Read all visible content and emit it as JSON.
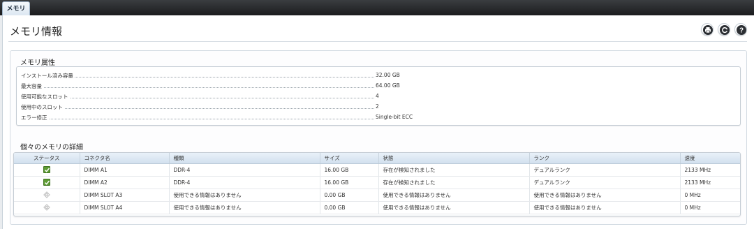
{
  "tab": {
    "label": "メモリ"
  },
  "page": {
    "title": "メモリ情報"
  },
  "toolbar": {
    "icons": [
      "printer-icon",
      "refresh-icon",
      "help-icon"
    ]
  },
  "memory_attributes": {
    "title": "メモリ属性",
    "rows": [
      {
        "label": "インストール済み容量",
        "value": "32.00 GB"
      },
      {
        "label": "最大容量",
        "value": "64.00 GB"
      },
      {
        "label": "使用可能なスロット",
        "value": "4"
      },
      {
        "label": "使用中のスロット",
        "value": "2"
      },
      {
        "label": "エラー修正",
        "value": "Single-bit ECC"
      }
    ]
  },
  "memory_details": {
    "title": "個々のメモリの詳細",
    "columns": [
      "ステータス",
      "コネクタ名",
      "種類",
      "サイズ",
      "状態",
      "ランク",
      "速度"
    ],
    "rows": [
      {
        "status_icon": "ok-check-icon",
        "connector": "DIMM A1",
        "type": "DDR-4",
        "size": "16.00 GB",
        "state": "存在が検知されました",
        "rank": "デュアルランク",
        "speed": "2133 MHz"
      },
      {
        "status_icon": "ok-check-icon",
        "connector": "DIMM A2",
        "type": "DDR-4",
        "size": "16.00 GB",
        "state": "存在が検知されました",
        "rank": "デュアルランク",
        "speed": "2133 MHz"
      },
      {
        "status_icon": "unavailable-icon",
        "connector": "DIMM SLOT A3",
        "type": "使用できる情報はありません",
        "size": "0.00 GB",
        "state": "使用できる情報はありません",
        "rank": "使用できる情報はありません",
        "speed": "0 MHz"
      },
      {
        "status_icon": "unavailable-icon",
        "connector": "DIMM SLOT A4",
        "type": "使用できる情報はありません",
        "size": "0.00 GB",
        "state": "使用できる情報はありません",
        "rank": "使用できる情報はありません",
        "speed": "0 MHz"
      }
    ]
  },
  "colors": {
    "status_ok": "#5e9c34",
    "header_gradient_top": "#e9f1f9",
    "header_gradient_bottom": "#d2e0ee",
    "topbar": "#1b1c1e"
  }
}
